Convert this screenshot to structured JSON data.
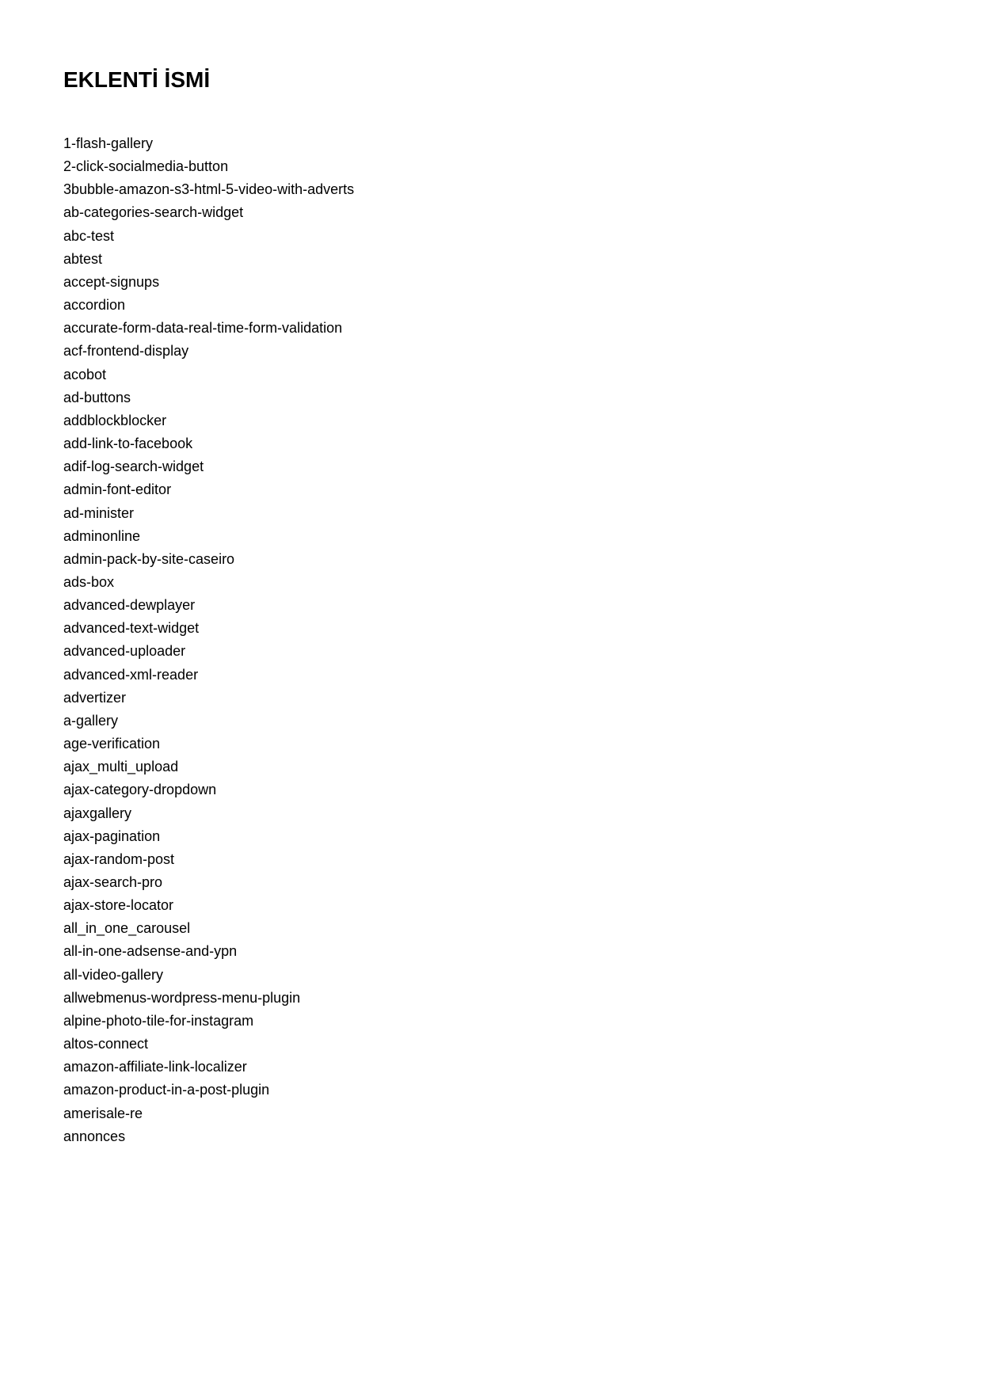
{
  "title": "EKLENTİ İSMİ",
  "items": [
    "1-flash-gallery",
    "2-click-socialmedia-button",
    "3bubble-amazon-s3-html-5-video-with-adverts",
    "ab-categories-search-widget",
    "abc-test",
    "abtest",
    "accept-signups",
    "accordion",
    "accurate-form-data-real-time-form-validation",
    "acf-frontend-display",
    "acobot",
    "ad-buttons",
    "addblockblocker",
    "add-link-to-facebook",
    "adif-log-search-widget",
    "admin-font-editor",
    "ad-minister",
    "adminonline",
    "admin-pack-by-site-caseiro",
    "ads-box",
    "advanced-dewplayer",
    "advanced-text-widget",
    "advanced-uploader",
    "advanced-xml-reader",
    "advertizer",
    "a-gallery",
    "age-verification",
    "ajax_multi_upload",
    "ajax-category-dropdown",
    "ajaxgallery",
    "ajax-pagination",
    "ajax-random-post",
    "ajax-search-pro",
    "ajax-store-locator",
    "all_in_one_carousel",
    "all-in-one-adsense-and-ypn",
    "all-video-gallery",
    "allwebmenus-wordpress-menu-plugin",
    "alpine-photo-tile-for-instagram",
    "altos-connect",
    "amazon-affiliate-link-localizer",
    "amazon-product-in-a-post-plugin",
    "amerisale-re",
    "annonces"
  ]
}
